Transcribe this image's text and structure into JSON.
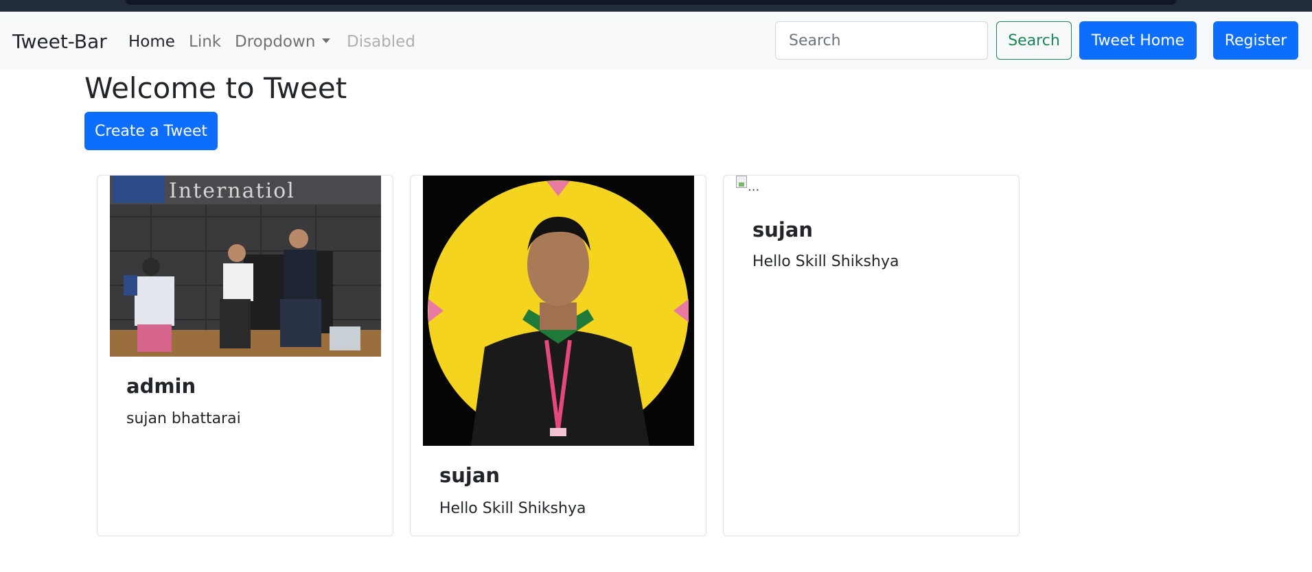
{
  "navbar": {
    "brand": "Tweet-Bar",
    "links": [
      {
        "label": "Home",
        "state": "active"
      },
      {
        "label": "Link",
        "state": "normal"
      },
      {
        "label": "Dropdown",
        "state": "dropdown"
      },
      {
        "label": "Disabled",
        "state": "disabled"
      }
    ],
    "search_placeholder": "Search",
    "search_button": "Search",
    "tweet_home_button": "Tweet Home",
    "register_button": "Register"
  },
  "main": {
    "title": "Welcome to Tweet",
    "create_button": "Create a Tweet"
  },
  "tweets": [
    {
      "title": "admin",
      "text": "sujan bhattarai",
      "image": "group-photo"
    },
    {
      "title": "sujan",
      "text": "Hello Skill Shikshya",
      "image": "profile-portrait"
    },
    {
      "title": "sujan",
      "text": "Hello Skill Shikshya",
      "image_alt": "..."
    }
  ],
  "colors": {
    "primary": "#0d6efd",
    "success": "#198754",
    "navbar_bg": "#f8f9fa",
    "portrait_bg": "#f5d41f"
  }
}
